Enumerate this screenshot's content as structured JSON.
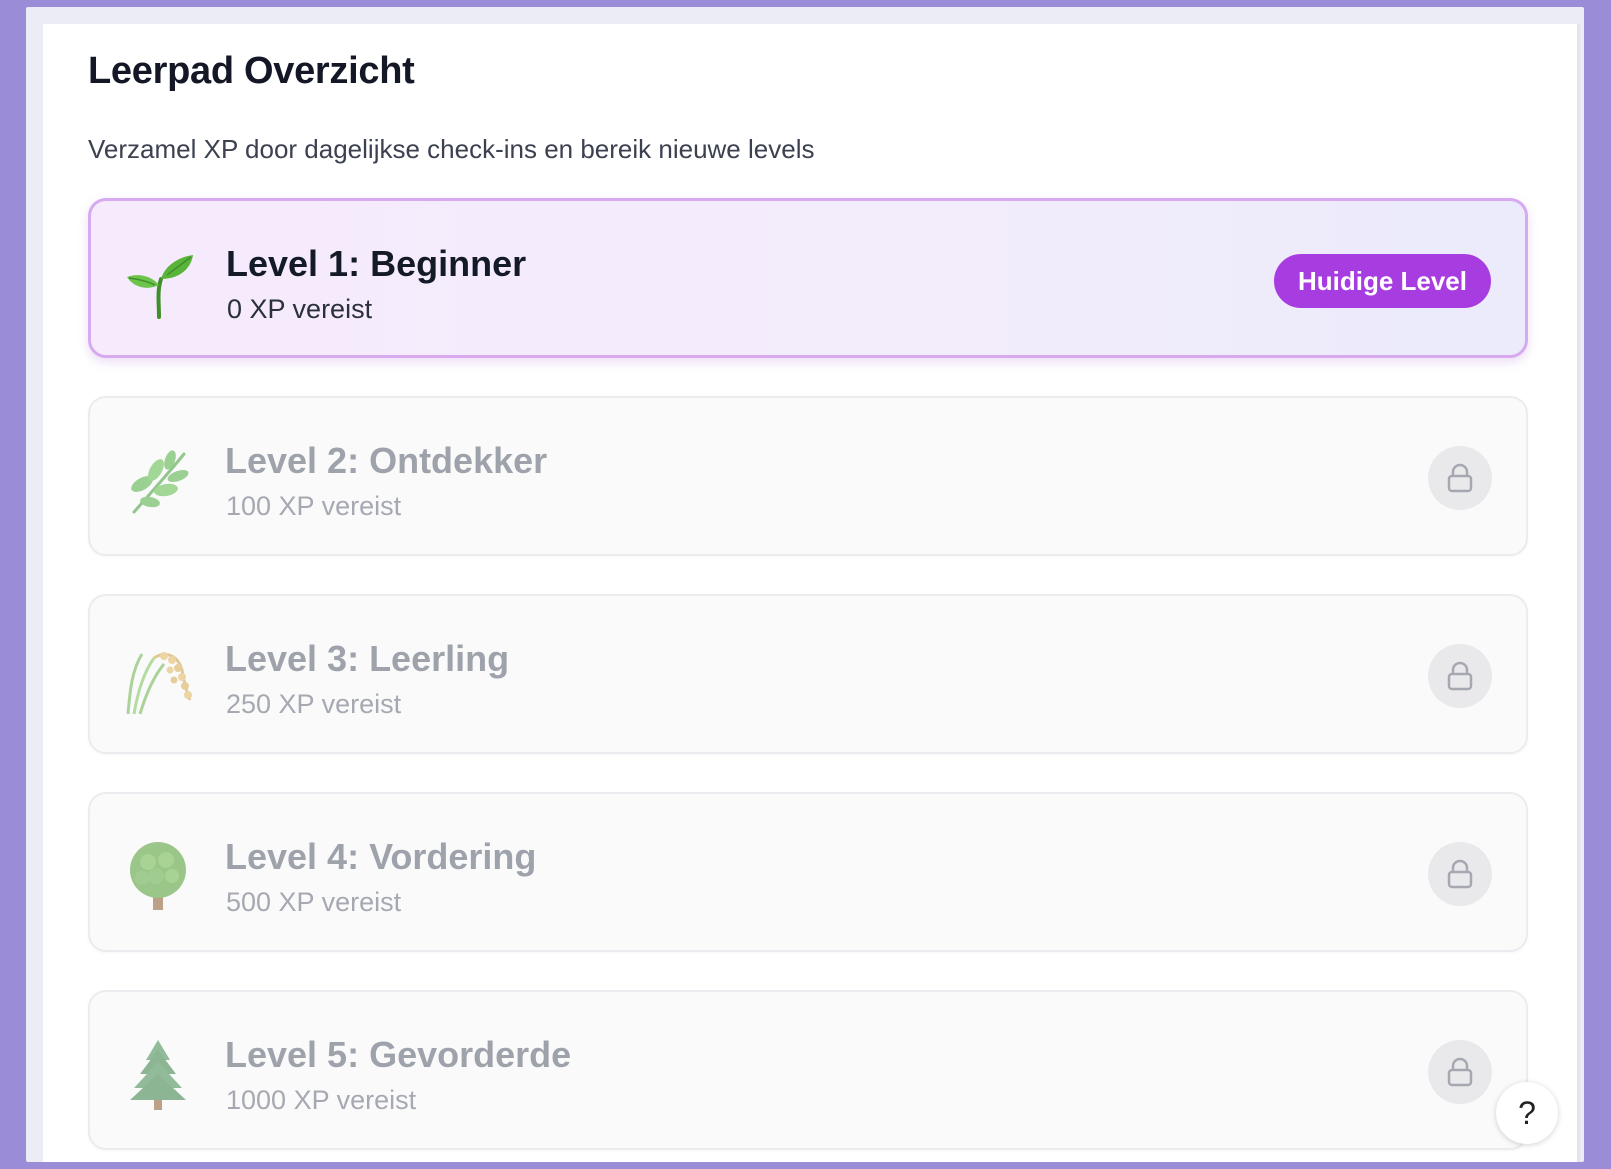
{
  "header": {
    "title": "Leerpad Overzicht",
    "subtitle": "Verzamel XP door dagelijkse check-ins en bereik nieuwe levels"
  },
  "levels": [
    {
      "name": "Level 1: Beginner",
      "xp": "0 XP vereist",
      "icon": "seedling-icon",
      "status": "current",
      "badge": "Huidige Level"
    },
    {
      "name": "Level 2: Ontdekker",
      "xp": "100 XP vereist",
      "icon": "herb-icon",
      "status": "locked"
    },
    {
      "name": "Level 3: Leerling",
      "xp": "250 XP vereist",
      "icon": "rice-sheaf-icon",
      "status": "locked"
    },
    {
      "name": "Level 4: Vordering",
      "xp": "500 XP vereist",
      "icon": "deciduous-tree-icon",
      "status": "locked"
    },
    {
      "name": "Level 5: Gevorderde",
      "xp": "1000 XP vereist",
      "icon": "evergreen-tree-icon",
      "status": "locked"
    }
  ],
  "help": {
    "label": "?"
  },
  "colors": {
    "accent": "#a73de0",
    "current_border": "#d7aaf0",
    "frame": "#9a8cd6"
  }
}
